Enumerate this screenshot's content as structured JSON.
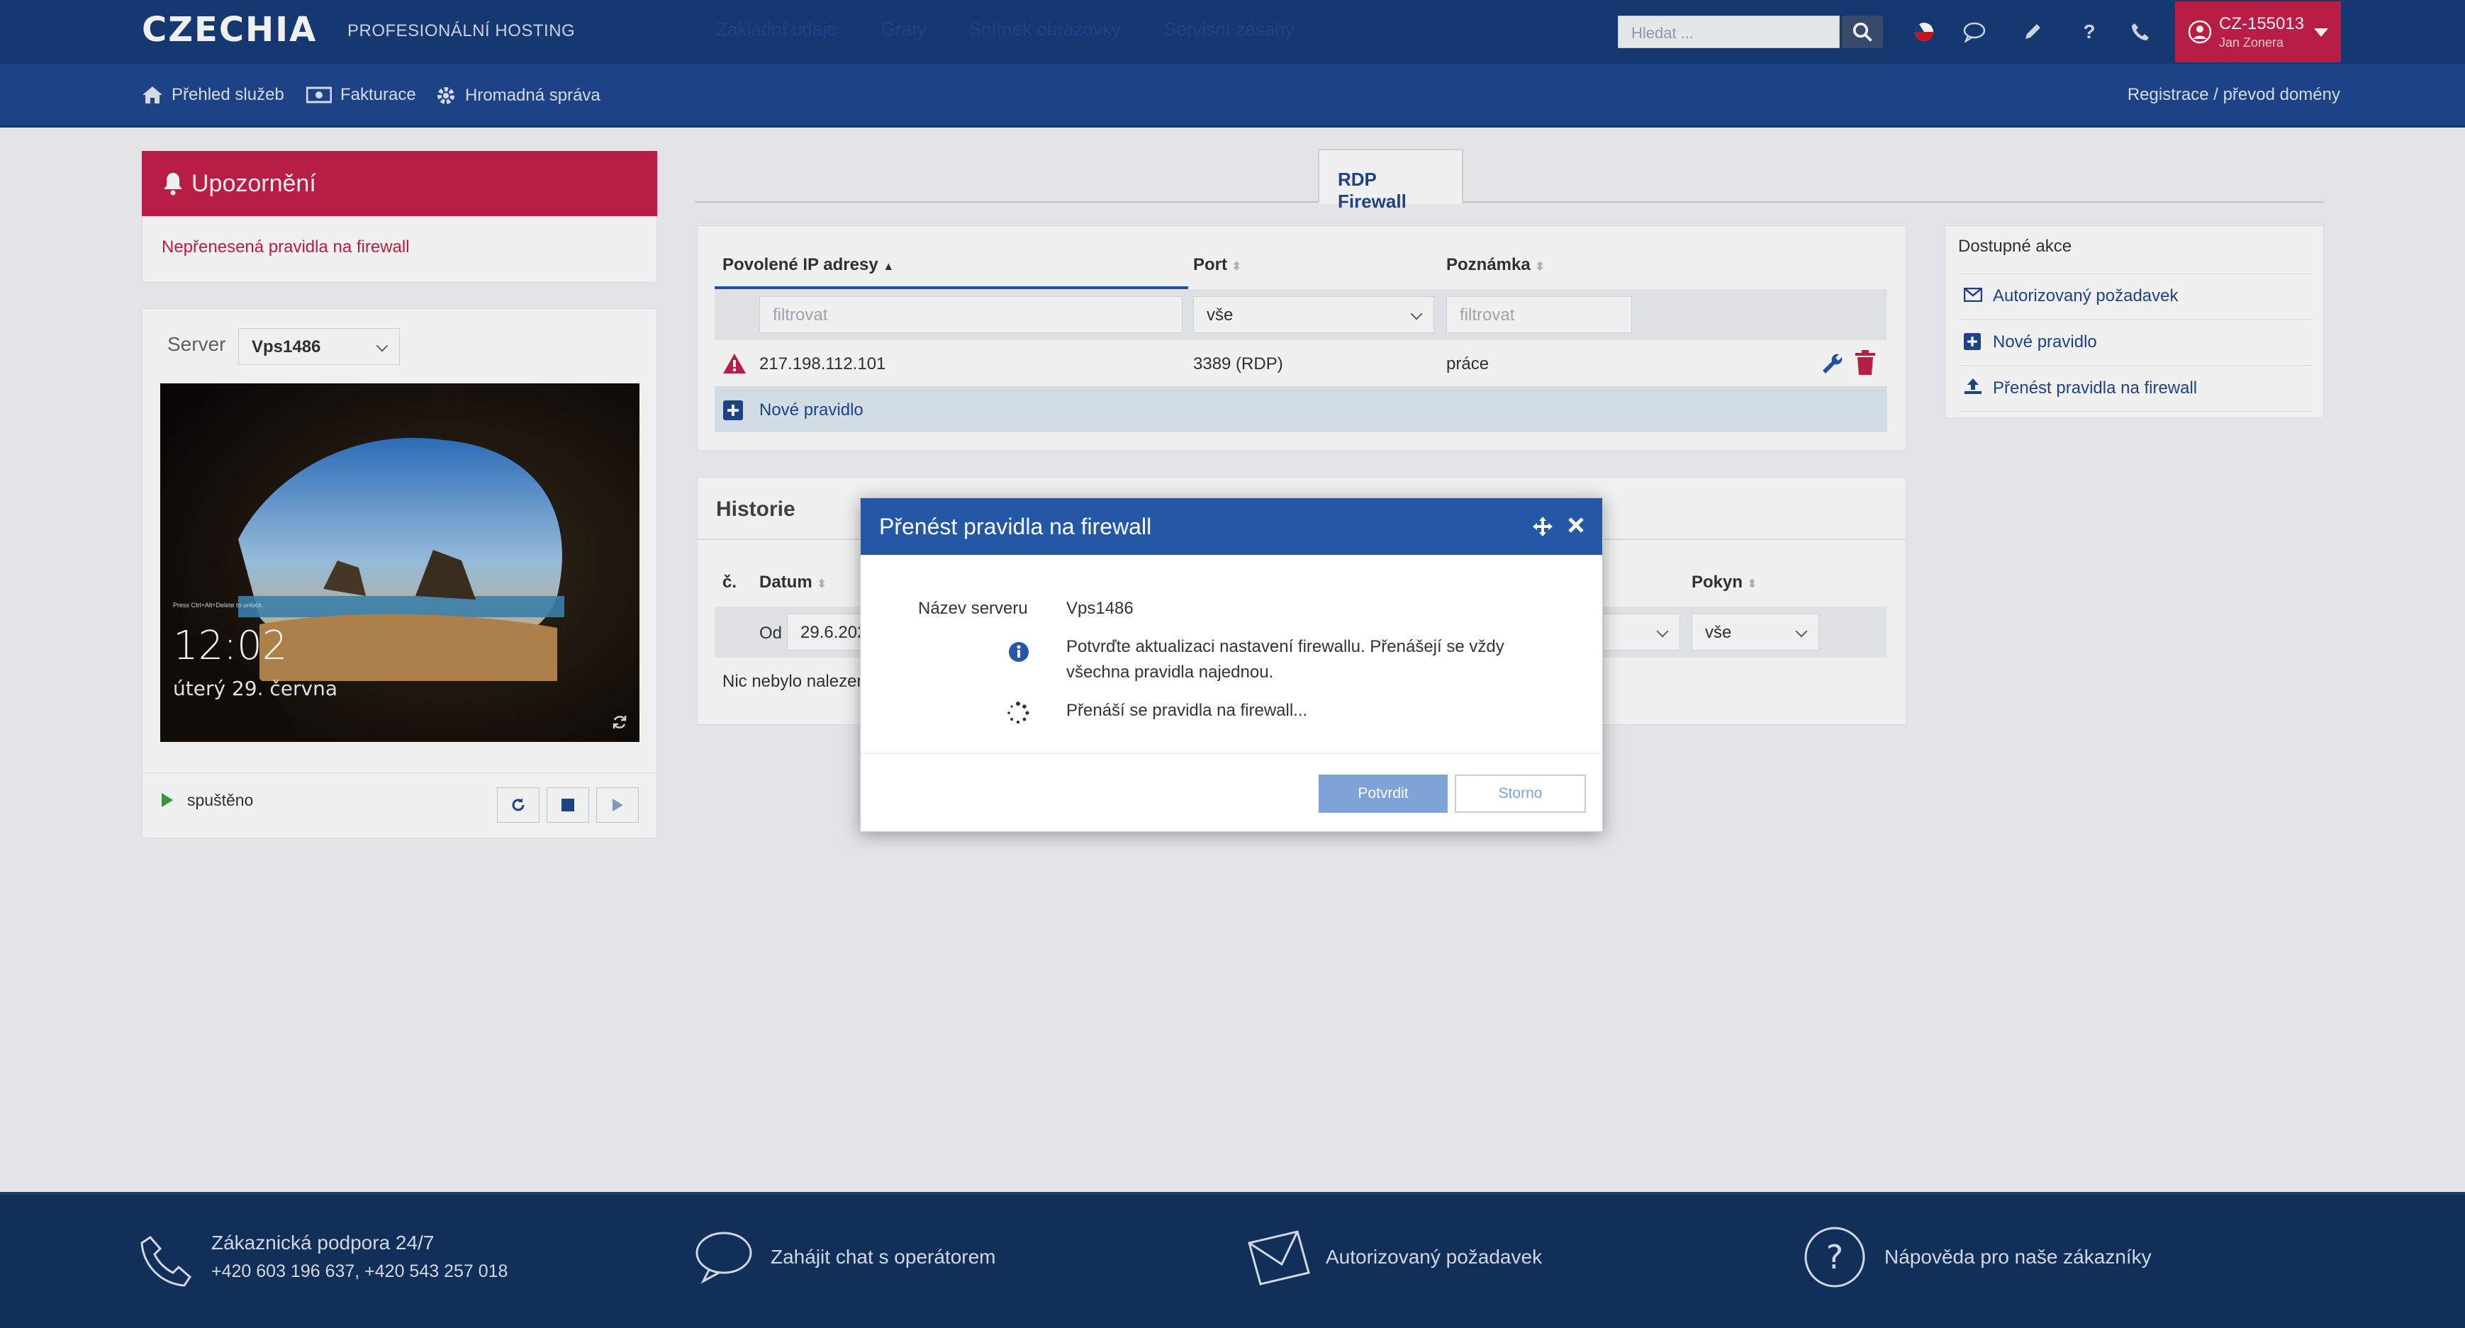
{
  "header": {
    "logo": "CZECHIA",
    "subtitle": "PROFESIONÁLNÍ HOSTING",
    "search_placeholder": "Hledat ...",
    "user_id": "CZ-155013",
    "user_name": "Jan Zonera",
    "icons": [
      "search-icon",
      "flag-cz-icon",
      "chat-icon",
      "pencil-icon",
      "help-icon",
      "phone-icon",
      "user-icon",
      "caret-down-icon"
    ]
  },
  "nav": {
    "items": [
      {
        "label": "Přehled služeb",
        "icon": "home-icon"
      },
      {
        "label": "Fakturace",
        "icon": "money-icon"
      },
      {
        "label": "Hromadná správa",
        "icon": "gear-icon"
      }
    ],
    "right_link": "Registrace / převod domény"
  },
  "alert": {
    "title": "Upozornění",
    "link": "Nepřenesená pravidla na firewall"
  },
  "server": {
    "label": "Server",
    "selected": "Vps1486",
    "screen_time": "12:02",
    "screen_date": "úterý 29. června",
    "status": "spuštěno"
  },
  "tabs": [
    {
      "label": "Základní údaje",
      "active": false
    },
    {
      "label": "Grafy",
      "active": false
    },
    {
      "label": "Snímek obrazovky",
      "active": false
    },
    {
      "label": "Servisní zásahy",
      "active": false
    },
    {
      "label": "RDP Firewall",
      "active": true
    }
  ],
  "firewall": {
    "columns": [
      "Povolené IP adresy",
      "Port",
      "Poznámka"
    ],
    "filter_placeholder": "filtrovat",
    "port_filter": "vše",
    "rows": [
      {
        "ip": "217.198.112.101",
        "port": "3389 (RDP)",
        "note": "práce"
      }
    ],
    "new_rule": "Nové pravidlo"
  },
  "history": {
    "title": "Historie",
    "col_no": "č.",
    "col_date": "Datum",
    "col_command": "Pokyn",
    "from_label": "Od",
    "from_value": "29.6.202",
    "command_filter": "vše",
    "empty": "Nic nebylo nalezen"
  },
  "actions": {
    "title": "Dostupné akce",
    "items": [
      {
        "label": "Autorizovaný požadavek",
        "icon": "envelope-icon"
      },
      {
        "label": "Nové pravidlo",
        "icon": "plus-square-icon"
      },
      {
        "label": "Přenést pravidla na firewall",
        "icon": "upload-icon"
      }
    ]
  },
  "modal": {
    "title": "Přenést pravidla na firewall",
    "server_label": "Název serveru",
    "server_value": "Vps1486",
    "info_line1": "Potvrďte aktualizaci nastavení firewallu. Přenášejí se vždy",
    "info_line2": "všechna pravidla najednou.",
    "progress": "Přenáší se pravidla na firewall...",
    "confirm": "Potvrdit",
    "cancel": "Storno"
  },
  "footer": {
    "support_title": "Zákaznická podpora 24/7",
    "support_phones": "+420 603 196 637, +420 543 257 018",
    "chat": "Zahájit chat s operátorem",
    "request": "Autorizovaný požadavek",
    "help": "Nápověda pro naše zákazníky"
  },
  "colors": {
    "brand_dark": "#183c78",
    "brand_nav": "#1f478f",
    "accent_red": "#c4204a",
    "modal_head": "#2458a6",
    "footer": "#13325f"
  }
}
